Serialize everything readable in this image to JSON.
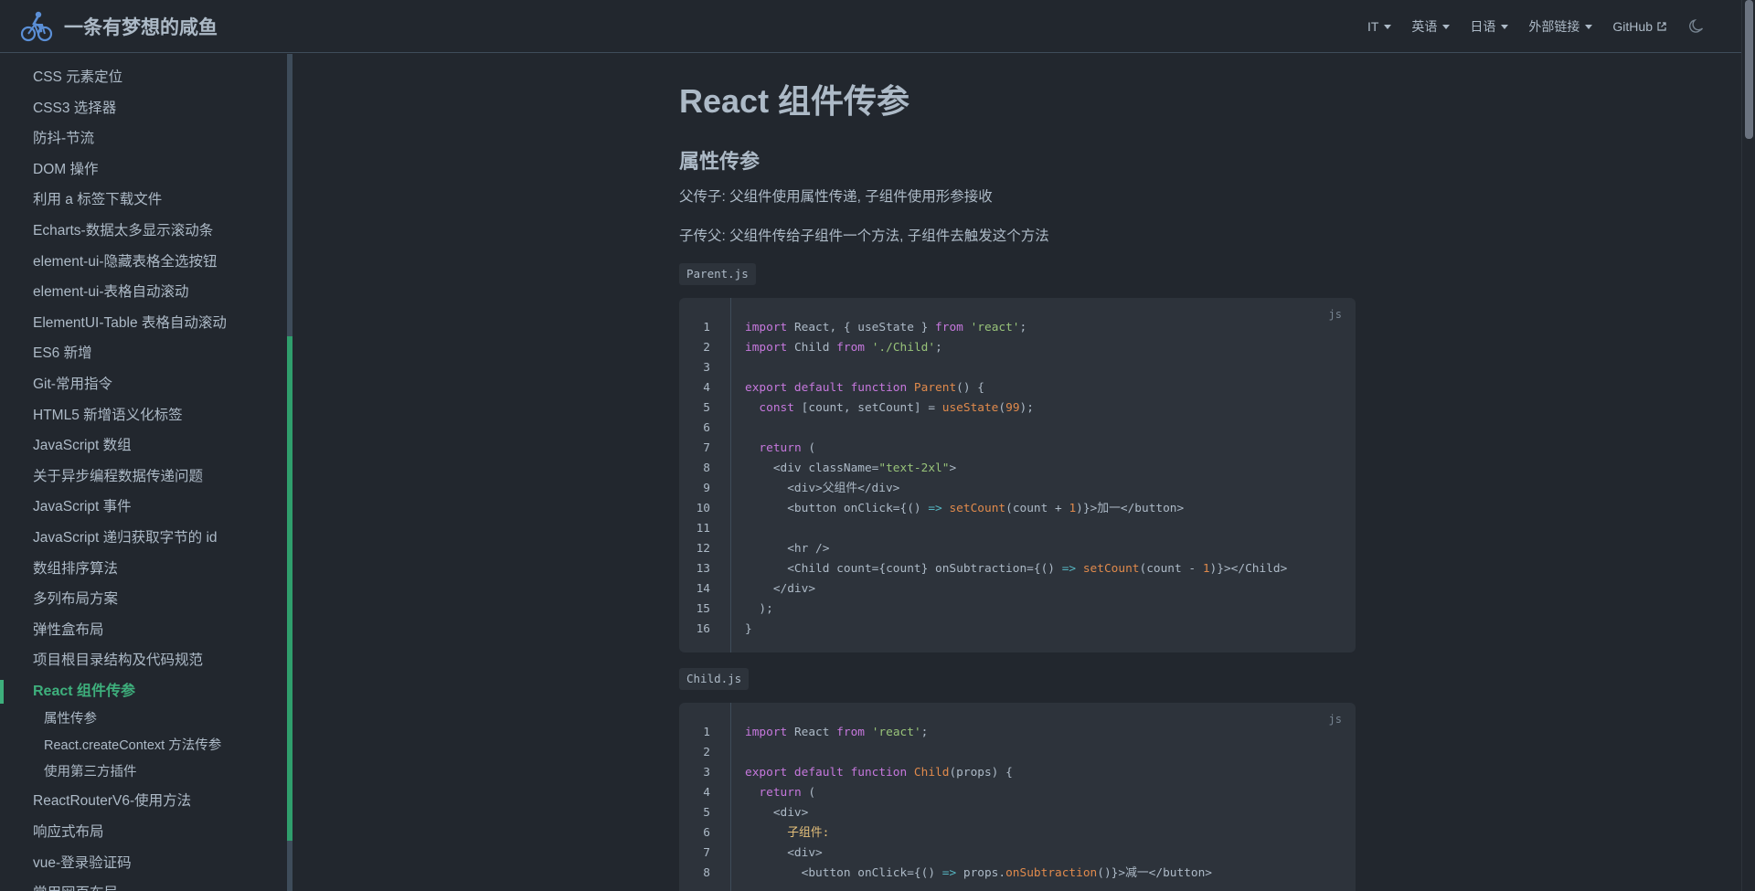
{
  "navbar": {
    "title": "一条有梦想的咸鱼",
    "links": [
      {
        "label": "IT",
        "dropdown": true
      },
      {
        "label": "英语",
        "dropdown": true
      },
      {
        "label": "日语",
        "dropdown": true
      },
      {
        "label": "外部链接",
        "dropdown": true
      },
      {
        "label": "GitHub",
        "external": true
      }
    ],
    "theme_icon": "moon-icon"
  },
  "sidebar": {
    "items": [
      "CSS 元素定位",
      "CSS3 选择器",
      "防抖-节流",
      "DOM 操作",
      "利用 a 标签下载文件",
      "Echarts-数据太多显示滚动条",
      "element-ui-隐藏表格全选按钮",
      "element-ui-表格自动滚动",
      "ElementUI-Table 表格自动滚动",
      "ES6 新增",
      "Git-常用指令",
      "HTML5 新增语义化标签",
      "JavaScript 数组",
      "关于异步编程数据传递问题",
      "JavaScript 事件",
      "JavaScript 递归获取字节的 id",
      "数组排序算法",
      "多列布局方案",
      "弹性盒布局",
      "项目根目录结构及代码规范"
    ],
    "active": "React 组件传参",
    "subitems": [
      "属性传参",
      "React.createContext 方法传参",
      "使用第三方插件"
    ],
    "after": [
      "ReactRouterV6-使用方法",
      "响应式布局",
      "vue-登录验证码",
      "常用网页布局"
    ]
  },
  "content": {
    "title": "React 组件传参",
    "section_title": "属性传参",
    "para1": "父传子: 父组件使用属性传递, 子组件使用形参接收",
    "para2": "子传父: 父组件传给子组件一个方法, 子组件去触发这个方法",
    "file1": "Parent.js",
    "file2": "Child.js",
    "lang": "js"
  },
  "colors": {
    "background": "#22272e",
    "code_background": "#2d333b",
    "accent": "#3eaf7c"
  }
}
